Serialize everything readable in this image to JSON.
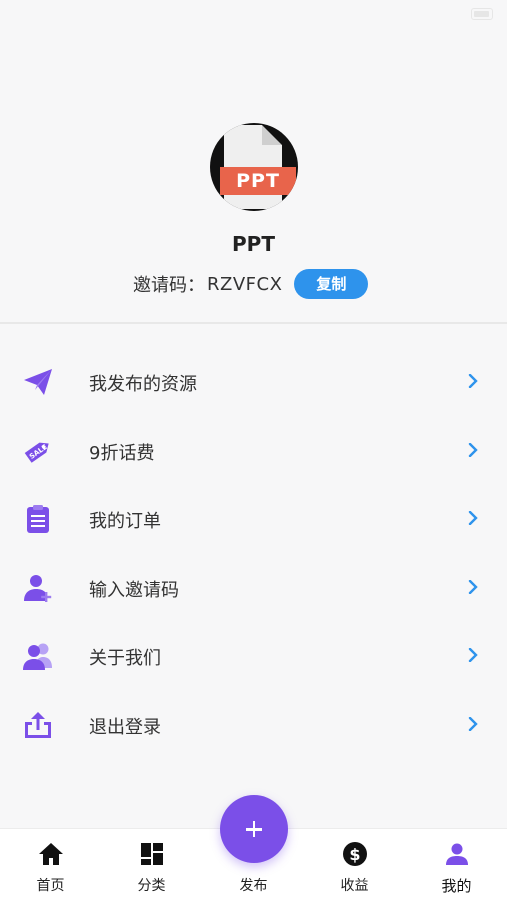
{
  "profile": {
    "avatar_text": "PPT",
    "username": "PPT",
    "invite_label": "邀请码：",
    "invite_code": "RZVFCX",
    "copy_label": "复制"
  },
  "menu": {
    "items": [
      {
        "label": "我发布的资源",
        "icon": "paper-plane-icon"
      },
      {
        "label": "9折话费",
        "icon": "sale-tag-icon"
      },
      {
        "label": "我的订单",
        "icon": "clipboard-icon"
      },
      {
        "label": "输入邀请码",
        "icon": "add-user-icon"
      },
      {
        "label": "关于我们",
        "icon": "group-icon"
      },
      {
        "label": "退出登录",
        "icon": "logout-icon"
      }
    ]
  },
  "tabbar": {
    "items": [
      {
        "label": "首页",
        "icon": "home-icon"
      },
      {
        "label": "分类",
        "icon": "category-icon"
      },
      {
        "label": "发布",
        "icon": "plus-icon"
      },
      {
        "label": "收益",
        "icon": "dollar-icon"
      },
      {
        "label": "我的",
        "icon": "user-icon"
      }
    ],
    "active": "我的"
  },
  "colors": {
    "accent_purple": "#7b4fe8",
    "copy_button_blue": "#2e93ec",
    "chevron_blue": "#2e93ec"
  }
}
